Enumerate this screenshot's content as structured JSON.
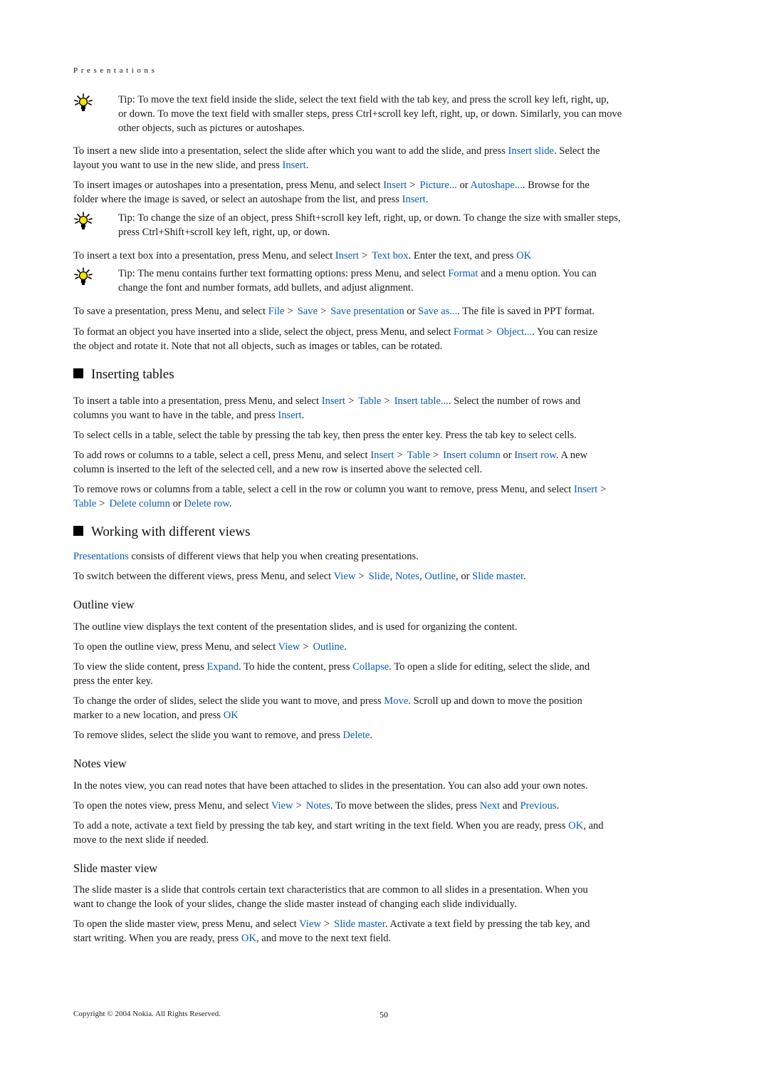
{
  "header": {
    "running_title": "Presentations"
  },
  "tips": [
    {
      "label": "Tip:",
      "lines": [
        "To move the text field inside the slide, select the text field with the tab key, and press the scroll key left, right, up,",
        "or down. To move the text field with smaller steps, press Ctrl+scroll key left, right, up, or down. Similarly, you can move",
        "other objects, such as pictures or autoshapes."
      ]
    },
    {
      "label": "Tip:",
      "lines": [
        "To change the size of an object, press Shift+scroll key left, right, up, or down. To change the size with smaller steps,",
        "press Ctrl+Shift+scroll key left, right, up, or down."
      ]
    },
    {
      "label": "Tip:",
      "text_a": "The menu contains further text formatting options: press Menu, and select ",
      "link_a": "Format",
      "text_b": " and a menu option. You can",
      "line2": "change the font and number formats, add bullets, and adjust alignment."
    }
  ],
  "p_insert_slide": {
    "t1": "To insert a new slide into a presentation, select the slide after which you want to add the slide, and press ",
    "l1": "Insert slide",
    "t2": ". Select the",
    "t3": "layout you want to use in the new slide, and press ",
    "l2": "Insert",
    "t4": "."
  },
  "p_insert_images": {
    "t1": "To insert images or autoshapes into a presentation, press Menu, and select ",
    "l1": "Insert",
    "sep": ">",
    "l2": "Picture...",
    "t2": " or ",
    "l3": "Autoshape...",
    "t3": ". Browse for the",
    "t4": "folder where the image is saved, or select an autoshape from the list, and press ",
    "l4": "Insert",
    "t5": "."
  },
  "p_text_box": {
    "t1": "To insert a text box into a presentation, press Menu, and select ",
    "l1": "Insert",
    "sep": ">",
    "l2": "Text box",
    "t2": ". Enter the text, and press ",
    "l3": "OK",
    "t3": "."
  },
  "p_save": {
    "t1": "To save a presentation, press Menu, and select ",
    "l1": "File",
    "sep": ">",
    "l2": "Save",
    "l3": "Save presentation",
    "t2": " or ",
    "l4": "Save as...",
    "t3": ". The file is saved in PPT format."
  },
  "p_format": {
    "t1": "To format an object you have inserted into a slide, select the object, press Menu, and select ",
    "l1": "Format",
    "sep": ">",
    "l2": "Object...",
    "t2": ". You can resize",
    "t3": "the object and rotate it. Note that not all objects, such as images or tables, can be rotated."
  },
  "section_tables": {
    "heading": "Inserting tables",
    "p1": {
      "t1": "To insert a table into a presentation, press Menu, and select ",
      "l1": "Insert",
      "sep": ">",
      "l2": "Table",
      "l3": "Insert table...",
      "t2": ". Select the number of rows and",
      "t3": "columns you want to have in the table, and press ",
      "l4": "Insert",
      "t4": "."
    },
    "p2": "To select cells in a table, select the table by pressing the tab key, then press the enter key. Press the tab key to select cells.",
    "p3": {
      "t1": "To add rows or columns to a table, select a cell, press Menu, and select ",
      "l1": "Insert",
      "sep": ">",
      "l2": "Table",
      "l3": "Insert column",
      "t2": " or ",
      "l4": "Insert row",
      "t3": ". A new",
      "t4": "column is inserted to the left of the selected cell, and a new row is inserted above the selected cell."
    },
    "p4": {
      "t1": "To remove rows or columns from a table, select a cell in the row or column you want to remove, press Menu, and select ",
      "l1": "Insert",
      "sep": ">",
      "l2": "Table",
      "l3": "Delete column",
      "t2": " or ",
      "l4": "Delete row",
      "t3": "."
    }
  },
  "section_views": {
    "heading": "Working with different views",
    "p1": {
      "l1": "Presentations",
      "t1": " consists of different views that help you when creating presentations."
    },
    "p2": {
      "t1": "To switch between the different views, press Menu, and select ",
      "l1": "View",
      "sep": ">",
      "l2": "Slide",
      "c1": ", ",
      "l3": "Notes",
      "c2": ", ",
      "l4": "Outline",
      "t2": ", or ",
      "l5": "Slide master",
      "t3": "."
    }
  },
  "outline_view": {
    "heading": "Outline view",
    "p1": "The outline view displays the text content of the presentation slides, and is used for organizing the content.",
    "p2": {
      "t1": "To open the outline view, press Menu, and select ",
      "l1": "View",
      "sep": ">",
      "l2": "Outline",
      "t2": "."
    },
    "p3": {
      "t1": "To view the slide content, press ",
      "l1": "Expand",
      "t2": ". To hide the content, press ",
      "l2": "Collapse",
      "t3": ". To open a slide for editing, select the slide, and",
      "t4": "press the enter key."
    },
    "p4": {
      "t1": "To change the order of slides, select the slide you want to move, and press ",
      "l1": "Move",
      "t2": ". Scroll up and down to move the position",
      "t3": "marker to a new location, and press ",
      "l2": "OK",
      "t4": "."
    },
    "p5": {
      "t1": "To remove slides, select the slide you want to remove, and press ",
      "l1": "Delete",
      "t2": "."
    }
  },
  "notes_view": {
    "heading": "Notes view",
    "p1": "In the notes view, you can read notes that have been attached to slides in the presentation. You can also add your own notes.",
    "p2": {
      "t1": "To open the notes view, press Menu, and select ",
      "l1": "View",
      "sep": ">",
      "l2": "Notes",
      "t2": ". To move between the slides, press ",
      "l3": "Next",
      "t3": " and ",
      "l4": "Previous",
      "t4": "."
    },
    "p3": {
      "t1": "To add a note, activate a text field by pressing the tab key, and start writing in the text field. When you are ready, press ",
      "l1": "OK",
      "t2": ", and",
      "t3": "move to the next slide if needed."
    }
  },
  "slide_master_view": {
    "heading": "Slide master view",
    "p1a": "The slide master is a slide that controls certain text characteristics that are common to all slides in a presentation. When you",
    "p1b": "want to change the look of your slides, change the slide master instead of changing each slide individually.",
    "p2": {
      "t1": "To open the slide master view, press Menu, and select ",
      "l1": "View",
      "sep": ">",
      "l2": "Slide master",
      "t2": ". Activate a text field by pressing the tab key, and",
      "t3": "start writing. When you are ready, press ",
      "l3": "OK",
      "t4": ", and move to the next text field."
    }
  },
  "footer": {
    "copyright": "Copyright © 2004 Nokia. All Rights Reserved.",
    "page_number": "50"
  },
  "colors": {
    "link": "#0b5cb5",
    "text": "#1a1a1a",
    "bulb_yellow": "#f2e400"
  }
}
